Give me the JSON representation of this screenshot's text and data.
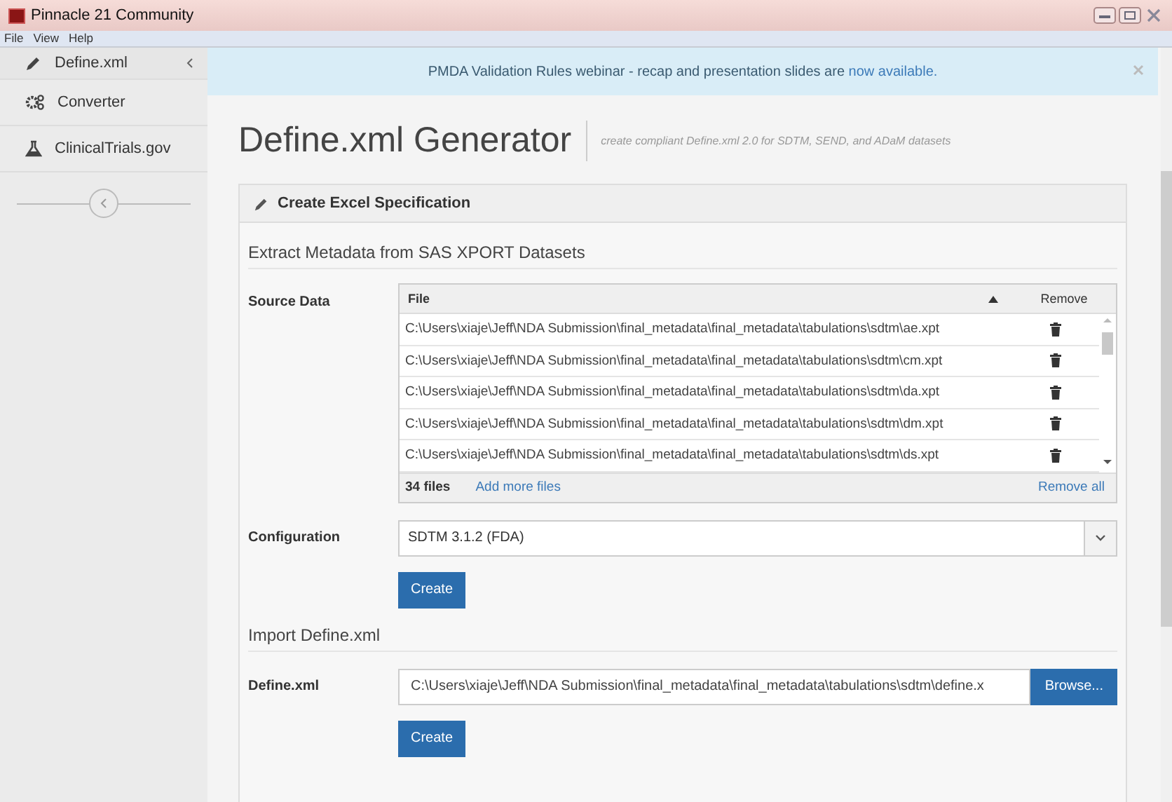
{
  "window": {
    "title": "Pinnacle 21 Community"
  },
  "menu": [
    "File",
    "View",
    "Help"
  ],
  "sidebar": {
    "items": [
      {
        "label": "Define.xml",
        "kind": "pencil",
        "selected": true
      },
      {
        "label": "Converter",
        "kind": "gears",
        "selected": false
      },
      {
        "label": "ClinicalTrials.gov",
        "kind": "flask",
        "selected": false
      }
    ]
  },
  "banner": {
    "text": "PMDA Validation Rules webinar - recap and presentation slides are ",
    "link": "now available."
  },
  "page": {
    "title": "Define.xml Generator",
    "subtitle": "create compliant Define.xml 2.0 for SDTM, SEND, and ADaM datasets"
  },
  "panel": {
    "title": "Create Excel Specification",
    "section1": "Extract Metadata from SAS XPORT Datasets",
    "source_label": "Source Data",
    "table": {
      "columns": [
        "File",
        "Remove"
      ],
      "rows": [
        "C:\\Users\\xiaje\\Jeff\\NDA Submission\\final_metadata\\final_metadata\\tabulations\\sdtm\\ae.xpt",
        "C:\\Users\\xiaje\\Jeff\\NDA Submission\\final_metadata\\final_metadata\\tabulations\\sdtm\\cm.xpt",
        "C:\\Users\\xiaje\\Jeff\\NDA Submission\\final_metadata\\final_metadata\\tabulations\\sdtm\\da.xpt",
        "C:\\Users\\xiaje\\Jeff\\NDA Submission\\final_metadata\\final_metadata\\tabulations\\sdtm\\dm.xpt",
        "C:\\Users\\xiaje\\Jeff\\NDA Submission\\final_metadata\\final_metadata\\tabulations\\sdtm\\ds.xpt"
      ],
      "count": "34 files",
      "add": "Add more files",
      "remove_all": "Remove all"
    },
    "config_label": "Configuration",
    "config_value": "SDTM 3.1.2 (FDA)",
    "create1": "Create",
    "section2": "Import Define.xml",
    "define_label": "Define.xml",
    "define_value": "C:\\Users\\xiaje\\Jeff\\NDA Submission\\final_metadata\\final_metadata\\tabulations\\sdtm\\define.x",
    "browse": "Browse...",
    "create2": "Create"
  }
}
